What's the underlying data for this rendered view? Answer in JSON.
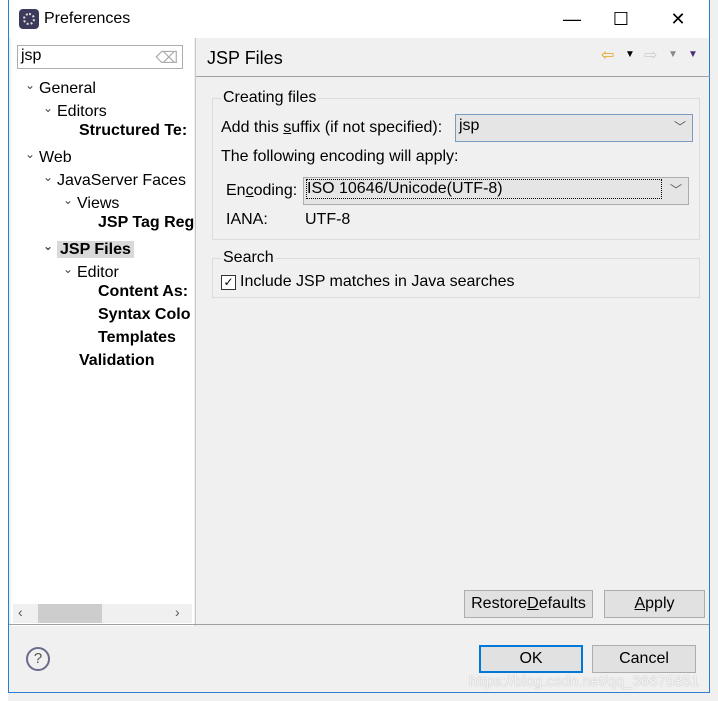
{
  "window": {
    "title": "Preferences",
    "minimize": "—",
    "maximize": "☐",
    "close": "✕"
  },
  "tree": {
    "filter_value": "jsp",
    "items": [
      {
        "label": "General",
        "level": 0,
        "expanded": true
      },
      {
        "label": "Editors",
        "level": 1,
        "expanded": true
      },
      {
        "label": "Structured Te:",
        "level": 2,
        "bold": true
      },
      {
        "label": "Web",
        "level": 0,
        "expanded": true
      },
      {
        "label": "JavaServer Faces",
        "level": 1,
        "expanded": true
      },
      {
        "label": "Views",
        "level": 2,
        "expanded": true
      },
      {
        "label": "JSP Tag Reg",
        "level": 3,
        "bold": true
      },
      {
        "label": "JSP Files",
        "level": 1,
        "expanded": true,
        "bold": true,
        "selected": true
      },
      {
        "label": "Editor",
        "level": 2,
        "expanded": true
      },
      {
        "label": "Content As:",
        "level": 3,
        "bold": true
      },
      {
        "label": "Syntax Colo",
        "level": 3,
        "bold": true
      },
      {
        "label": "Templates",
        "level": 3,
        "bold": true
      },
      {
        "label": "Validation",
        "level": 2,
        "bold": true
      }
    ]
  },
  "page": {
    "title": "JSP Files",
    "creating_group": {
      "legend": "Creating files",
      "suffix_label_pre": "Add this ",
      "suffix_label_u": "s",
      "suffix_label_post": "uffix (if not specified):",
      "suffix_value": "jsp",
      "encoding_intro": "The following encoding will apply:",
      "encoding_label_pre": "En",
      "encoding_label_u": "c",
      "encoding_label_post": "oding:",
      "encoding_value": "ISO 10646/Unicode(UTF-8)",
      "iana_label": "IANA:",
      "iana_value": "UTF-8"
    },
    "search_group": {
      "legend": "Search",
      "checkbox_label": "Include JSP matches in Java searches",
      "checked": true
    },
    "restore_pre": "Restore ",
    "restore_u": "D",
    "restore_post": "efaults",
    "apply_u": "A",
    "apply_post": "pply"
  },
  "footer": {
    "ok": "OK",
    "cancel": "Cancel"
  },
  "watermark": "https://blog.csdn.net/qq_36675851",
  "colors": {
    "accent": "#0078d7",
    "back_arrow": "#e8a317",
    "menu_arrow": "#4b2a7a"
  }
}
